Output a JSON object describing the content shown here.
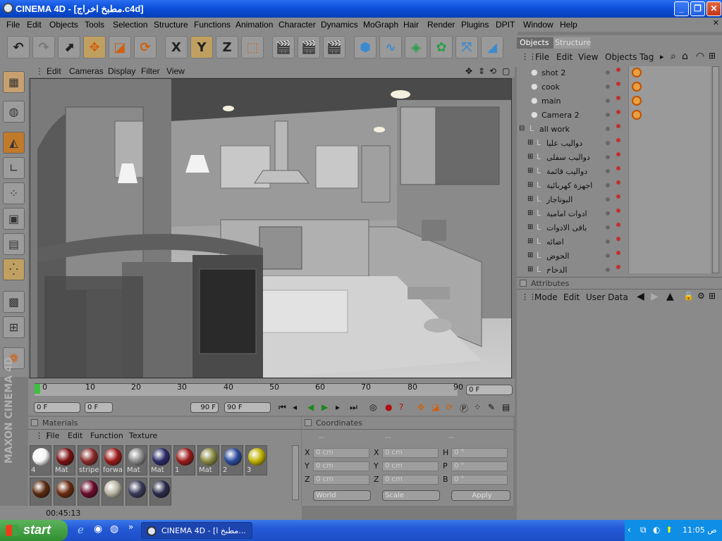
{
  "window": {
    "title": "CINEMA 4D - [مطبخ اخراج.c4d]"
  },
  "menubar": [
    "File",
    "Edit",
    "Objects",
    "Tools",
    "Selection",
    "Structure",
    "Functions",
    "Animation",
    "Character",
    "Dynamics",
    "MoGraph",
    "Hair",
    "Render",
    "Plugins",
    "DPIT",
    "Window",
    "Help"
  ],
  "toolbar": {
    "x_label": "X",
    "y_label": "Y",
    "z_label": "Z"
  },
  "viewport": {
    "menu": [
      "Edit",
      "Cameras",
      "Display",
      "Filter",
      "View"
    ]
  },
  "timeline": {
    "ticks": [
      "0",
      "10",
      "20",
      "30",
      "40",
      "50",
      "60",
      "70",
      "80",
      "90"
    ],
    "current_frame": "0 F",
    "start_field": "0 F",
    "range_start": "0 F",
    "range_end": "90 F",
    "end_field": "90 F"
  },
  "materials": {
    "header": "Materials",
    "menu": [
      "File",
      "Edit",
      "Function",
      "Texture"
    ],
    "items": [
      {
        "label": "4",
        "color": "#f4f4f4"
      },
      {
        "label": "Mat",
        "color": "#7a1010"
      },
      {
        "label": "stripe",
        "color": "#8a2a2a"
      },
      {
        "label": "forwa",
        "color": "#9a1a1a"
      },
      {
        "label": "Mat",
        "color": "#8a8a8a"
      },
      {
        "label": "Mat",
        "color": "#2a2a6a"
      },
      {
        "label": "1",
        "color": "#9a1a1a"
      },
      {
        "label": "Mat",
        "color": "#8a8a40"
      },
      {
        "label": "2",
        "color": "#2a4a9a"
      },
      {
        "label": "3",
        "color": "#c0b000"
      },
      {
        "label": "",
        "color": "#5a2a10"
      },
      {
        "label": "",
        "color": "#6a2a10"
      },
      {
        "label": "",
        "color": "#6a0a2a"
      },
      {
        "label": "",
        "color": "#b8b4a0"
      },
      {
        "label": "",
        "color": "#3a3a5a"
      },
      {
        "label": "",
        "color": "#2a2a4a"
      }
    ],
    "status_time": "00:45:13"
  },
  "coordinates": {
    "header": "Coordinates",
    "col_headers": [
      "--",
      "--",
      "--"
    ],
    "rows": [
      {
        "a": "X",
        "v1": "0 cm",
        "b": "X",
        "v2": "0 cm",
        "c": "H",
        "v3": "0 °"
      },
      {
        "a": "Y",
        "v1": "0 cm",
        "b": "Y",
        "v2": "0 cm",
        "c": "P",
        "v3": "0 °"
      },
      {
        "a": "Z",
        "v1": "0 cm",
        "b": "Z",
        "v2": "0 cm",
        "c": "B",
        "v3": "0 °"
      }
    ],
    "world_select": "World",
    "scale_select": "Scale",
    "apply_label": "Apply"
  },
  "objects_panel": {
    "tabs": [
      "Objects",
      "Structure"
    ],
    "menu": [
      "File",
      "Edit",
      "View",
      "Objects",
      "Tag"
    ],
    "rows": [
      {
        "name": "shot 2",
        "tags": true
      },
      {
        "name": "cook",
        "tags": true
      },
      {
        "name": "main",
        "tags": true
      },
      {
        "name": "Camera 2",
        "tags": true
      },
      {
        "name": "all work",
        "tags": false
      },
      {
        "name": "دواليب عليا",
        "tags": false
      },
      {
        "name": "دواليب سفلى",
        "tags": false
      },
      {
        "name": "دواليب قائمة",
        "tags": false
      },
      {
        "name": "اجهزة كهربائية",
        "tags": false
      },
      {
        "name": "البوتاجاز",
        "tags": false
      },
      {
        "name": "ادوات امامية",
        "tags": false
      },
      {
        "name": "باقى الادوات",
        "tags": false
      },
      {
        "name": "اضائه",
        "tags": false
      },
      {
        "name": "الحوض",
        "tags": false
      },
      {
        "name": "الدخاخ",
        "tags": false
      }
    ]
  },
  "attributes_panel": {
    "header": "Attributes",
    "menu": [
      "Mode",
      "Edit",
      "User Data"
    ]
  },
  "taskbar": {
    "start_label": "start",
    "task_label": "CINEMA 4D - [مطبخ ا...",
    "clock": "ص 11:05"
  }
}
